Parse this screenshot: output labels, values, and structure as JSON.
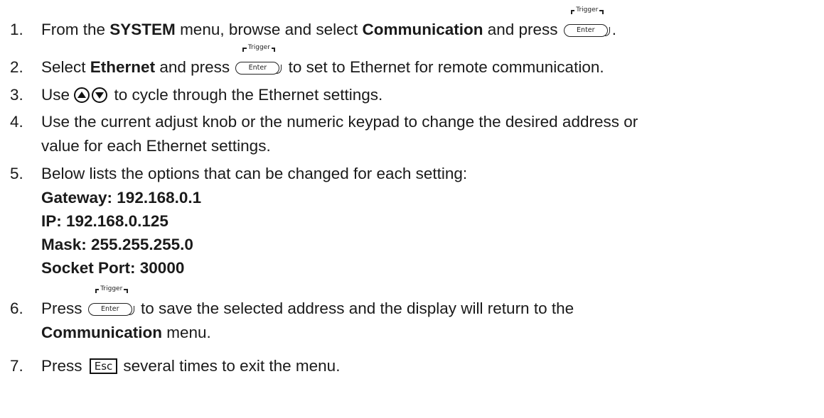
{
  "key_labels": {
    "trigger": "Trigger",
    "enter": "Enter",
    "esc": "Esc"
  },
  "steps": [
    {
      "num": "1.",
      "a": "From the ",
      "b1": "SYSTEM",
      "c": " menu, browse and select ",
      "b2": "Communication",
      "d": " and press ",
      "e": "."
    },
    {
      "num": "2.",
      "a": "Select ",
      "b1": "Ethernet",
      "c": " and press ",
      "d": " to set to Ethernet for remote communication."
    },
    {
      "num": "3.",
      "a": "Use ",
      "b": " to cycle through the Ethernet settings."
    },
    {
      "num": "4.",
      "line1": "Use the current adjust knob or the numeric keypad to change the desired address or",
      "line2": "value for each Ethernet settings."
    },
    {
      "num": "5.",
      "line1": "Below lists the options that can be changed for each setting:",
      "settings": [
        "Gateway:  192.168.0.1",
        "IP: 192.168.0.125",
        "Mask: 255.255.255.0",
        "Socket Port: 30000"
      ]
    },
    {
      "num": "6.",
      "a": "Press ",
      "b": " to save the selected address and the display will return to the",
      "line2": "Communication",
      "line2b": " menu."
    },
    {
      "num": "7.",
      "a": "Press ",
      "b": "several times to exit the menu."
    }
  ]
}
